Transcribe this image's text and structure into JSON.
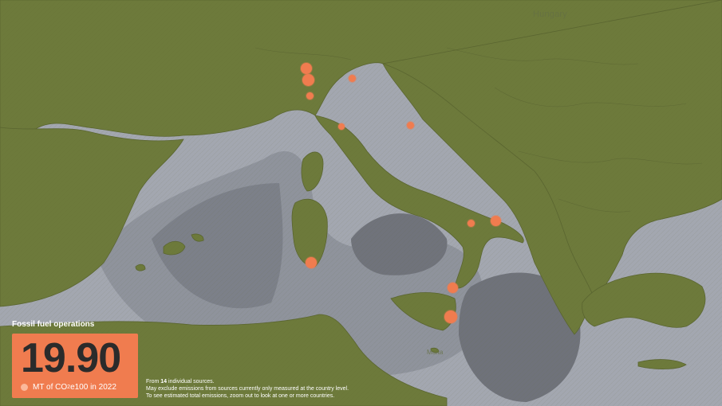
{
  "map": {
    "labels": {
      "hungary": "Hungary",
      "malta": "Malta"
    },
    "colors": {
      "land": "#6e7a3d",
      "sea_shallow": "#a8acb4",
      "sea_mid": "#8e929b",
      "sea_deep": "#70737b",
      "marker": "#f07c4f"
    }
  },
  "panel": {
    "title": "Fossil fuel operations",
    "value": "19.90",
    "unit_prefix": "MT of CO",
    "unit_sub": "2",
    "unit_suffix": "e100 in 2022",
    "legend_marker": "circle"
  },
  "footnote": {
    "line1_prefix": "From ",
    "line1_count": "14",
    "line1_suffix": " individual sources.",
    "line2": "May exclude emissions from sources currently only measured at the country level.",
    "line3": "To see estimated total emissions, zoom out to look at one or more countries."
  }
}
